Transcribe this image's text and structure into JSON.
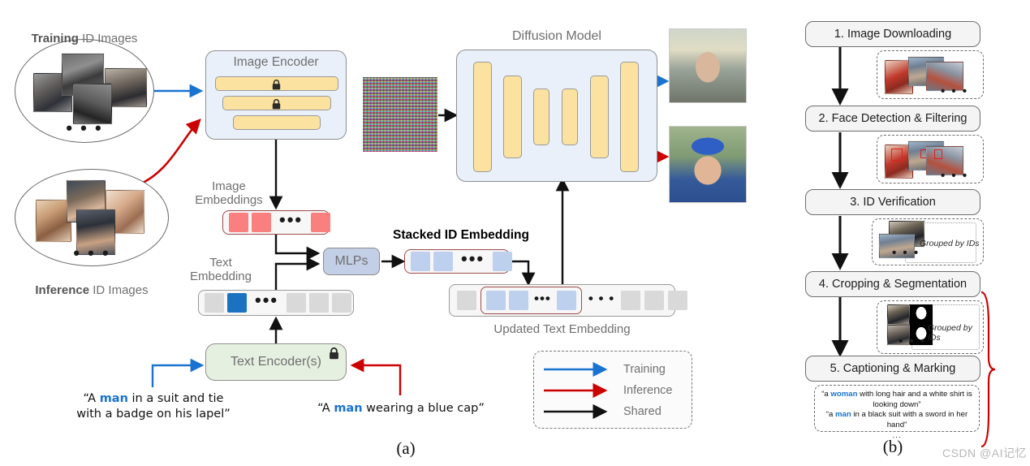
{
  "figure": {
    "caption_a": "(a)",
    "caption_b": "(b)",
    "watermark": "CSDN @AI记忆"
  },
  "panel_a": {
    "training_source": {
      "label_bold": "Training",
      "label_rest": " ID Images",
      "ellipsis": "• • •"
    },
    "inference_source": {
      "label_bold": "Inference",
      "label_rest": " ID Images",
      "ellipsis": "• • •"
    },
    "image_encoder": {
      "title": "Image Encoder",
      "layers": [
        {
          "locked": true
        },
        {
          "locked": true
        },
        {
          "locked": false
        }
      ],
      "lock_icon": "lock-icon"
    },
    "image_embeddings": {
      "label": "Image\nEmbeddings",
      "cells": [
        "red",
        "red",
        "dots",
        "red"
      ]
    },
    "text_embedding": {
      "label": "Text\nEmbedding",
      "cells": [
        "gray",
        "blue-solid",
        "dots",
        "gray",
        "gray",
        "gray"
      ]
    },
    "mlps": {
      "label": "MLPs"
    },
    "stacked_id_embedding": {
      "label": "Stacked ID Embedding",
      "cells": [
        "blue",
        "blue",
        "dots",
        "blue"
      ]
    },
    "updated_text_embedding": {
      "label": "Updated Text Embedding",
      "lead_cells": [
        "gray"
      ],
      "group_cells": [
        "blue",
        "blue",
        "dots",
        "blue"
      ],
      "mid_dots": "• • •",
      "tail_cells": [
        "gray",
        "gray",
        "gray"
      ]
    },
    "text_encoder": {
      "label": "Text Encoder(s)",
      "locked": true,
      "lock_icon": "lock-icon"
    },
    "diffusion_model": {
      "title": "Diffusion Model",
      "unet_blocks": [
        88,
        72,
        48,
        48,
        72,
        88
      ]
    },
    "noise_input": {
      "name": "noise-latent"
    },
    "outputs": [
      {
        "name": "training-output-image"
      },
      {
        "name": "inference-output-image"
      }
    ],
    "prompts": {
      "training": {
        "pre": "“A ",
        "hl": "man",
        "post": " in a suit and tie\nwith a badge on his lapel”"
      },
      "inference": {
        "pre": "“A ",
        "hl": "man",
        "post": " wearing a blue cap”"
      }
    },
    "legend": {
      "items": [
        {
          "label": "Training",
          "color": "#1a73d1"
        },
        {
          "label": "Inference",
          "color": "#cc0000"
        },
        {
          "label": "Shared",
          "color": "#111111"
        }
      ]
    }
  },
  "panel_b": {
    "steps": [
      {
        "label": "1. Image Downloading"
      },
      {
        "label": "2. Face Detection & Filtering"
      },
      {
        "label": "3. ID Verification"
      },
      {
        "label": "4. Cropping & Segmentation"
      },
      {
        "label": "5. Captioning & Marking"
      }
    ],
    "artifacts": [
      {
        "after_step": 1,
        "ellipsis": "• • •",
        "grouped_label": null
      },
      {
        "after_step": 2,
        "ellipsis": "• • •",
        "grouped_label": null
      },
      {
        "after_step": 3,
        "ellipsis": "• • •",
        "grouped_label": "Grouped by IDs"
      },
      {
        "after_step": 4,
        "ellipsis": "• • •",
        "grouped_label": "Grouped by IDs"
      }
    ],
    "captions": {
      "line1": {
        "pre": "“a ",
        "hl": "woman",
        "post": " with long hair and a white shirt is looking down”"
      },
      "line2": {
        "pre": "“a ",
        "hl": "man",
        "post": " in a black suit with a sword in her hand”"
      },
      "ellipsis": "..."
    }
  },
  "colors": {
    "training_arrow": "#1a73d1",
    "inference_arrow": "#cc0000",
    "shared_arrow": "#111111",
    "yellow_block": "#fbe2a0",
    "blue_cell": "#bdd0ee",
    "red_cell": "#fa7f7f",
    "gray_cell": "#d9d9d9",
    "panel_blue": "#e9f0fa",
    "panel_green": "#e6f0e0"
  }
}
